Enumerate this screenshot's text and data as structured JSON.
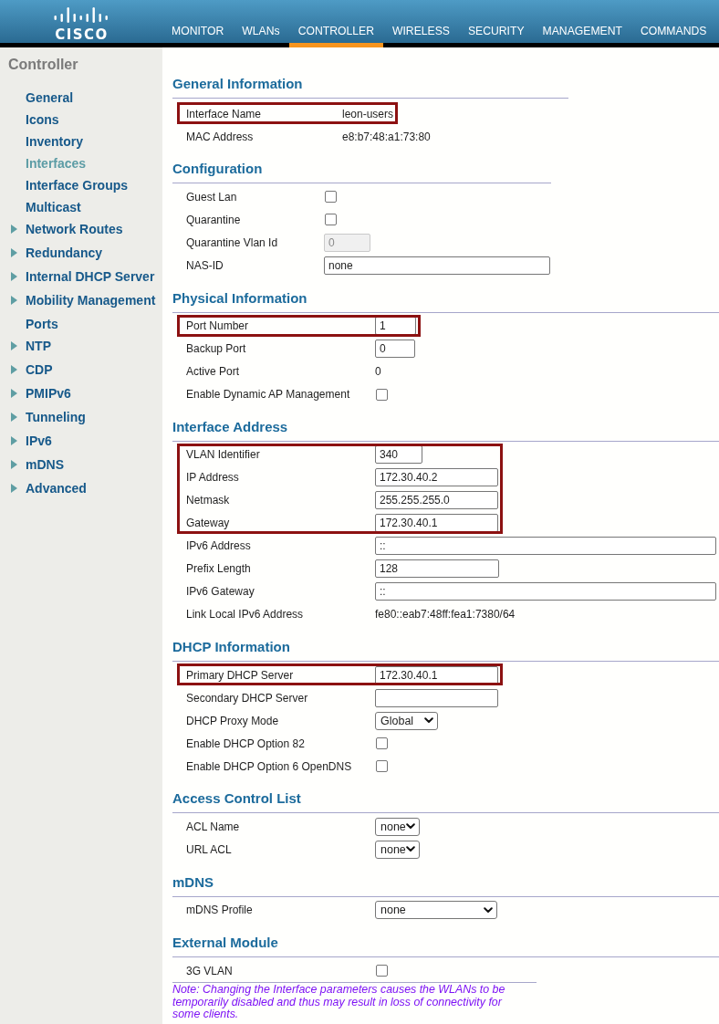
{
  "header": {
    "logo": "CISCO",
    "tabs": [
      {
        "label": "MONITOR",
        "selected": false
      },
      {
        "label": "WLANs",
        "selected": false
      },
      {
        "label": "CONTROLLER",
        "selected": true
      },
      {
        "label": "WIRELESS",
        "selected": false
      },
      {
        "label": "SECURITY",
        "selected": false
      },
      {
        "label": "MANAGEMENT",
        "selected": false
      },
      {
        "label": "COMMANDS",
        "selected": false
      }
    ]
  },
  "sidebar": {
    "title": "Controller",
    "items": [
      {
        "label": "General",
        "expandable": false,
        "selected": false
      },
      {
        "label": "Icons",
        "expandable": false,
        "selected": false
      },
      {
        "label": "Inventory",
        "expandable": false,
        "selected": false
      },
      {
        "label": "Interfaces",
        "expandable": false,
        "selected": true
      },
      {
        "label": "Interface Groups",
        "expandable": false,
        "selected": false
      },
      {
        "label": "Multicast",
        "expandable": false,
        "selected": false
      },
      {
        "label": "Network Routes",
        "expandable": true,
        "selected": false
      },
      {
        "label": "Redundancy",
        "expandable": true,
        "selected": false
      },
      {
        "label": "Internal DHCP Server",
        "expandable": true,
        "selected": false
      },
      {
        "label": "Mobility Management",
        "expandable": true,
        "selected": false
      },
      {
        "label": "Ports",
        "expandable": false,
        "selected": false
      },
      {
        "label": "NTP",
        "expandable": true,
        "selected": false
      },
      {
        "label": "CDP",
        "expandable": true,
        "selected": false
      },
      {
        "label": "PMIPv6",
        "expandable": true,
        "selected": false
      },
      {
        "label": "Tunneling",
        "expandable": true,
        "selected": false
      },
      {
        "label": "IPv6",
        "expandable": true,
        "selected": false
      },
      {
        "label": "mDNS",
        "expandable": true,
        "selected": false
      },
      {
        "label": "Advanced",
        "expandable": true,
        "selected": false
      }
    ]
  },
  "sections": [
    {
      "title": "General Information",
      "rows": [
        {
          "kind": "text",
          "label": "Interface Name",
          "value": "leon-users",
          "highlighted": true
        },
        {
          "kind": "text",
          "label": "MAC Address",
          "value": "e8:b7:48:a1:73:80",
          "highlighted": false
        }
      ]
    },
    {
      "title": "Configuration",
      "rows": [
        {
          "kind": "checkbox",
          "label": "Guest Lan",
          "checked": false,
          "highlighted": false
        },
        {
          "kind": "checkbox",
          "label": "Quarantine",
          "checked": false,
          "highlighted": false
        },
        {
          "kind": "input",
          "label": "Quarantine Vlan Id",
          "value": "0",
          "disabled": true,
          "highlighted": false
        },
        {
          "kind": "input",
          "label": "NAS-ID",
          "value": "none",
          "disabled": false,
          "highlighted": false
        }
      ]
    },
    {
      "title": "Physical Information",
      "rows": [
        {
          "kind": "input",
          "label": "Port Number",
          "value": "1",
          "disabled": false,
          "highlighted": true
        },
        {
          "kind": "input",
          "label": "Backup Port",
          "value": "0",
          "disabled": false,
          "highlighted": false
        },
        {
          "kind": "text",
          "label": "Active Port",
          "value": "0",
          "highlighted": false
        },
        {
          "kind": "checkbox",
          "label": "Enable Dynamic AP Management",
          "checked": false,
          "highlighted": false
        }
      ]
    },
    {
      "title": "Interface Address",
      "rows": [
        {
          "kind": "input",
          "label": "VLAN Identifier",
          "value": "340",
          "disabled": false,
          "highlighted": true
        },
        {
          "kind": "input",
          "label": "IP Address",
          "value": "172.30.40.2",
          "disabled": false,
          "highlighted": true
        },
        {
          "kind": "input",
          "label": "Netmask",
          "value": "255.255.255.0",
          "disabled": false,
          "highlighted": true
        },
        {
          "kind": "input",
          "label": "Gateway",
          "value": "172.30.40.1",
          "disabled": false,
          "highlighted": true
        },
        {
          "kind": "input",
          "label": "IPv6 Address",
          "value": "::",
          "disabled": false,
          "highlighted": false
        },
        {
          "kind": "input",
          "label": "Prefix Length",
          "value": "128",
          "disabled": false,
          "highlighted": false
        },
        {
          "kind": "input",
          "label": "IPv6 Gateway",
          "value": "::",
          "disabled": false,
          "highlighted": false
        },
        {
          "kind": "text",
          "label": "Link Local IPv6 Address",
          "value": "fe80::eab7:48ff:fea1:7380/64",
          "highlighted": false
        }
      ]
    },
    {
      "title": "DHCP Information",
      "rows": [
        {
          "kind": "input",
          "label": "Primary DHCP Server",
          "value": "172.30.40.1",
          "disabled": false,
          "highlighted": true
        },
        {
          "kind": "input",
          "label": "Secondary DHCP Server",
          "disabled": false,
          "highlighted": false
        },
        {
          "kind": "select",
          "label": "DHCP Proxy Mode",
          "value": "Global",
          "highlighted": false
        },
        {
          "kind": "checkbox",
          "label": "Enable DHCP Option 82",
          "checked": false,
          "highlighted": false
        },
        {
          "kind": "checkbox",
          "label": "Enable DHCP Option 6 OpenDNS",
          "checked": false,
          "highlighted": false
        }
      ]
    },
    {
      "title": "Access Control List",
      "rows": [
        {
          "kind": "select",
          "label": "ACL Name",
          "value": "none",
          "highlighted": false
        },
        {
          "kind": "select",
          "label": "URL ACL",
          "value": "none",
          "highlighted": false
        }
      ]
    },
    {
      "title": "mDNS",
      "rows": [
        {
          "kind": "select",
          "label": "mDNS Profile",
          "value": "none",
          "highlighted": false
        }
      ]
    },
    {
      "title": "External Module",
      "rows": [
        {
          "kind": "checkbox",
          "label": "3G VLAN",
          "checked": false,
          "highlighted": false
        }
      ]
    }
  ],
  "note": "Note: Changing the Interface parameters causes the WLANs to be temporarily disabled and thus may result in loss of connectivity for some clients."
}
